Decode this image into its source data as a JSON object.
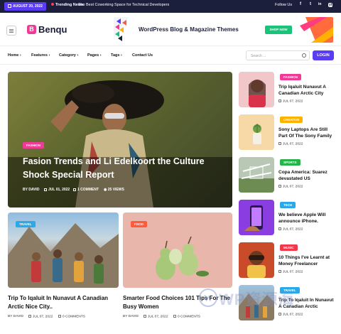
{
  "topbar": {
    "date": "AUGUST 20, 2022",
    "trending_label": "Trending News:",
    "trending_text": "The Best Coworking Space for Technical Developers",
    "follow_label": "Follow Us",
    "social": [
      "f",
      "t",
      "in",
      "yt"
    ]
  },
  "header": {
    "logo_letter": "B",
    "logo_text": "Benqu",
    "banner_text": "WordPress Blog & Magazine Themes",
    "banner_button": "SHOP NOW"
  },
  "nav": {
    "items": [
      "Home",
      "Features",
      "Category",
      "Pages",
      "Tags",
      "Contact Us"
    ],
    "search_placeholder": "Search ...",
    "login": "LOGIN"
  },
  "hero": {
    "category": "FASHION",
    "title": "Fasion Trends and Li Edelkoort the Culture Shock Special Report",
    "author": "BY DAVID",
    "date": "JUL 01, 2022",
    "comments": "1 COMMENT",
    "views": "25 VIEWS"
  },
  "cards": [
    {
      "category": "TRAVEL",
      "title": "Trip To Iqaluit In Nunavut A Canadian Arctic Nice City..",
      "author": "BY DAVID",
      "date": "JUL 07, 2022",
      "comments": "0 COMMENTS"
    },
    {
      "category": "FOOD",
      "title": "Smarter Food Choices 101 Tips For The Busy Women",
      "author": "BY DAVID",
      "date": "JUL 07, 2022",
      "comments": "0 COMMENTS"
    }
  ],
  "sidebar": [
    {
      "category": "FASHION",
      "title": "Trip Iqaluit Nunavut A Canadian Arctic City",
      "date": "JUL 07, 2022"
    },
    {
      "category": "CREATIVE",
      "title": "Sony Laptops Are Still Part Of The Sony Family",
      "date": "JUL 07, 2022"
    },
    {
      "category": "SPORTS",
      "title": "Copa America: Suarez devastated US",
      "date": "JUL 07, 2022"
    },
    {
      "category": "TECH",
      "title": "We believe Apple Will announce iPhone.",
      "date": "JUL 07, 2022"
    },
    {
      "category": "MUSIC",
      "title": "10 Things I've Learnt at Money Freelancer",
      "date": "JUL 07, 2022"
    },
    {
      "category": "TRAVEL",
      "title": "Trip To Iqaluit In Nunavut A Canadian Arctic",
      "date": "JUL 07, 2022"
    }
  ],
  "watermark": "WP资源海",
  "colors": {
    "accent": "#5b3cf5",
    "pink": "#f03a96",
    "topbar": "#1c1f3b",
    "green": "#17c47a"
  }
}
